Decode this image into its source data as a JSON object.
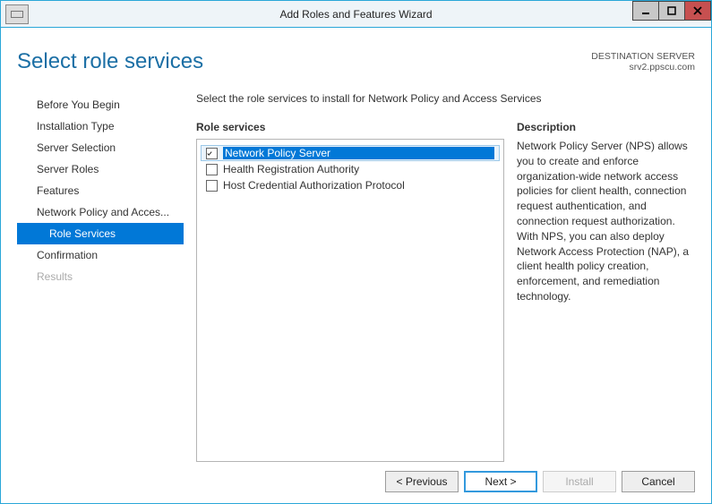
{
  "window": {
    "title": "Add Roles and Features Wizard"
  },
  "header": {
    "page_title": "Select role services",
    "destination_label": "DESTINATION SERVER",
    "destination_server": "srv2.ppscu.com"
  },
  "sidebar": {
    "steps": [
      {
        "label": "Before You Begin",
        "active": false,
        "disabled": false,
        "sub": false
      },
      {
        "label": "Installation Type",
        "active": false,
        "disabled": false,
        "sub": false
      },
      {
        "label": "Server Selection",
        "active": false,
        "disabled": false,
        "sub": false
      },
      {
        "label": "Server Roles",
        "active": false,
        "disabled": false,
        "sub": false
      },
      {
        "label": "Features",
        "active": false,
        "disabled": false,
        "sub": false
      },
      {
        "label": "Network Policy and Acces...",
        "active": false,
        "disabled": false,
        "sub": false
      },
      {
        "label": "Role Services",
        "active": true,
        "disabled": false,
        "sub": true
      },
      {
        "label": "Confirmation",
        "active": false,
        "disabled": false,
        "sub": false
      },
      {
        "label": "Results",
        "active": false,
        "disabled": true,
        "sub": false
      }
    ]
  },
  "content": {
    "instruction": "Select the role services to install for Network Policy and Access Services",
    "list_header": "Role services",
    "desc_header": "Description",
    "items": [
      {
        "label": "Network Policy Server",
        "checked": true,
        "selected": true
      },
      {
        "label": "Health Registration Authority",
        "checked": false,
        "selected": false
      },
      {
        "label": "Host Credential Authorization Protocol",
        "checked": false,
        "selected": false
      }
    ],
    "description": "Network Policy Server (NPS) allows you to create and enforce organization-wide network access policies for client health, connection request authentication, and connection request authorization. With NPS, you can also deploy Network Access Protection (NAP), a client health policy creation, enforcement, and remediation technology."
  },
  "buttons": {
    "previous": "< Previous",
    "next": "Next >",
    "install": "Install",
    "cancel": "Cancel"
  }
}
